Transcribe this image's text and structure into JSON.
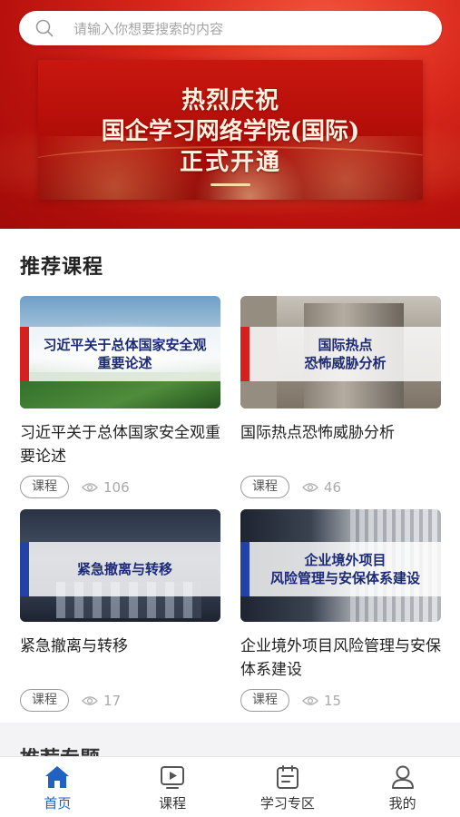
{
  "search": {
    "placeholder": "请输入你想要搜索的内容"
  },
  "banner": {
    "line1": "热烈庆祝",
    "line2": "国企学习网络学院(国际)",
    "line3": "正式开通"
  },
  "recommended": {
    "title": "推荐课程",
    "cards": [
      {
        "thumb_text": "习近平关于总体国家安全观\n重要论述",
        "title": "习近平关于总体国家安全观重要论述",
        "tag": "课程",
        "views": "106"
      },
      {
        "thumb_text": "国际热点\n恐怖威胁分析",
        "title": "国际热点恐怖威胁分析",
        "tag": "课程",
        "views": "46"
      },
      {
        "thumb_text": "紧急撤离与转移",
        "title": "紧急撤离与转移",
        "tag": "课程",
        "views": "17"
      },
      {
        "thumb_text": "企业境外项目\n风险管理与安保体系建设",
        "title": "企业境外项目风险管理与安保体系建设",
        "tag": "课程",
        "views": "15"
      }
    ]
  },
  "next_section_peek": "推荐专题",
  "tabbar": {
    "items": [
      {
        "label": "首页",
        "icon": "home-icon",
        "active": true
      },
      {
        "label": "课程",
        "icon": "video-play-icon",
        "active": false
      },
      {
        "label": "学习专区",
        "icon": "study-zone-icon",
        "active": false
      },
      {
        "label": "我的",
        "icon": "user-icon",
        "active": false
      }
    ]
  },
  "colors": {
    "accent": "#1f62c4",
    "hero_red": "#c8170f",
    "overlay_red": "#d61f1f",
    "overlay_blue": "#2243a5"
  }
}
